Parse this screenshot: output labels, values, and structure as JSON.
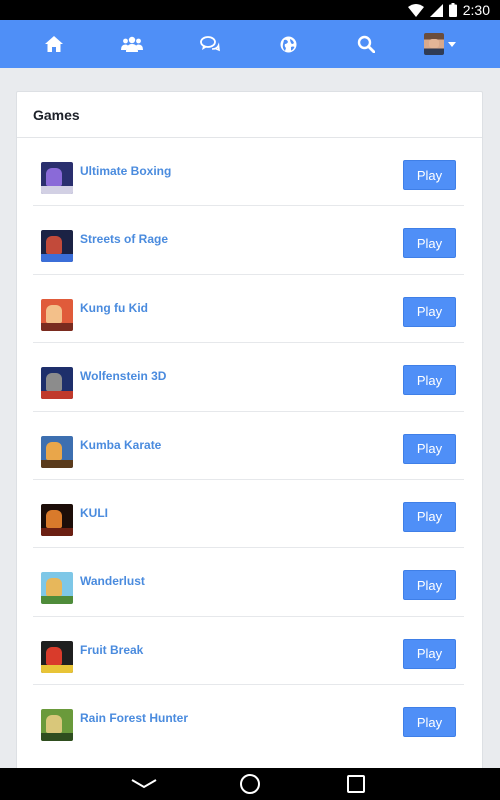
{
  "status_bar": {
    "time": "2:30"
  },
  "topnav": {
    "icons": [
      "home-icon",
      "people-icon",
      "chat-icon",
      "globe-icon",
      "search-icon",
      "avatar",
      "chevron-down-icon"
    ]
  },
  "card": {
    "title": "Games"
  },
  "games": [
    {
      "name": "Ultimate Boxing",
      "play_label": "Play",
      "thumb_colors": [
        "#2a2f6e",
        "#8a6ad8",
        "#d2d0e4"
      ]
    },
    {
      "name": "Streets of Rage",
      "play_label": "Play",
      "thumb_colors": [
        "#1b2244",
        "#c24a3a",
        "#3b6ed8"
      ]
    },
    {
      "name": "Kung fu Kid",
      "play_label": "Play",
      "thumb_colors": [
        "#e05b3a",
        "#f3c08a",
        "#7a2b1f"
      ]
    },
    {
      "name": "Wolfenstein 3D",
      "play_label": "Play",
      "thumb_colors": [
        "#1e2f6b",
        "#8c8c8c",
        "#c0392b"
      ]
    },
    {
      "name": "Kumba Karate",
      "play_label": "Play",
      "thumb_colors": [
        "#3d6fb0",
        "#e9a64a",
        "#5a3b1c"
      ]
    },
    {
      "name": "KULI",
      "play_label": "Play",
      "thumb_colors": [
        "#1c0d08",
        "#d97a2b",
        "#6b1f12"
      ]
    },
    {
      "name": "Wanderlust",
      "play_label": "Play",
      "thumb_colors": [
        "#7ec7e7",
        "#e7b75b",
        "#4f8c3a"
      ]
    },
    {
      "name": "Fruit Break",
      "play_label": "Play",
      "thumb_colors": [
        "#1f1f1f",
        "#d93b2b",
        "#e8c437"
      ]
    },
    {
      "name": "Rain Forest Hunter",
      "play_label": "Play",
      "thumb_colors": [
        "#6a9a3b",
        "#d9c77a",
        "#2f4e1f"
      ]
    }
  ],
  "colors": {
    "accent": "#4f8ff7",
    "link": "#4a8bde",
    "page_bg": "#e9ebee"
  }
}
